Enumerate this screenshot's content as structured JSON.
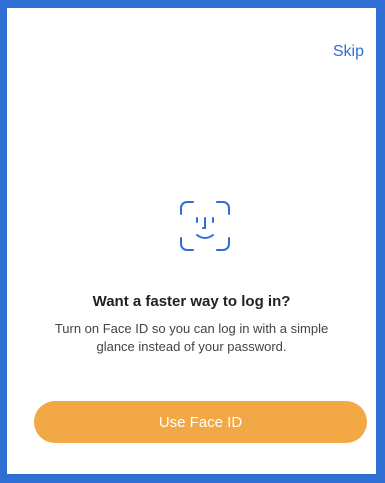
{
  "header": {
    "skip_label": "Skip"
  },
  "main": {
    "icon": "face-id-icon",
    "title": "Want a faster way to log in?",
    "subtitle": "Turn on Face ID so you can log in with a simple glance instead of your password."
  },
  "actions": {
    "primary_label": "Use Face ID"
  },
  "colors": {
    "frame": "#2f6fd4",
    "accent": "#2f6fd4",
    "button": "#f2a844"
  }
}
